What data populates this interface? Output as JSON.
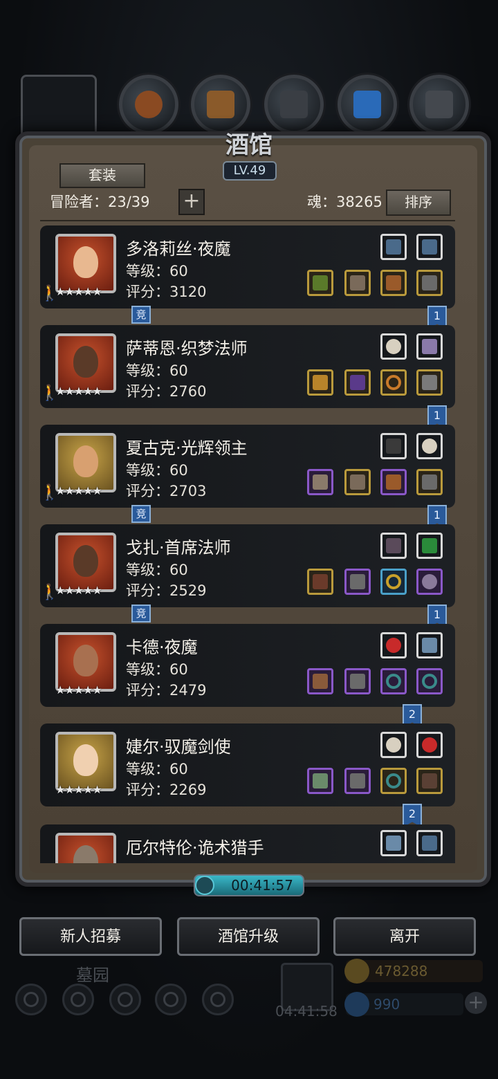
{
  "header": {
    "title": "酒馆",
    "level": "LV.49"
  },
  "toolbar": {
    "suit_label": "套装",
    "adventurers": "冒险者：23/39",
    "add_label": "+",
    "soul": "魂：38265",
    "sort_label": "排序"
  },
  "heroes": [
    {
      "name": "多洛莉丝·夜魔",
      "level": "等级：60",
      "score": "评分：3120",
      "stars": "★★★★★",
      "badge_left": "竞",
      "badge_right": "1"
    },
    {
      "name": "萨蒂恩·织梦法师",
      "level": "等级：60",
      "score": "评分：2760",
      "stars": "★★★★★",
      "badge_left": "",
      "badge_right": "1"
    },
    {
      "name": "夏古克·光辉领主",
      "level": "等级：60",
      "score": "评分：2703",
      "stars": "★★★★★",
      "badge_left": "竞",
      "badge_right": "1"
    },
    {
      "name": "戈扎·首席法师",
      "level": "等级：60",
      "score": "评分：2529",
      "stars": "★★★★★",
      "badge_left": "竞",
      "badge_right": "1"
    },
    {
      "name": "卡德·夜魔",
      "level": "等级：60",
      "score": "评分：2479",
      "stars": "★★★★★",
      "badge_left": "",
      "badge_right": "2"
    },
    {
      "name": "婕尔·驭魔剑使",
      "level": "等级：60",
      "score": "评分：2269",
      "stars": "★★★★★",
      "badge_left": "",
      "badge_right": "2"
    },
    {
      "name": "厄尔特伦·诡术猎手",
      "level": "",
      "score": "",
      "stars": "",
      "badge_left": "",
      "badge_right": ""
    }
  ],
  "timer": "00:41:57",
  "buttons": {
    "recruit": "新人招募",
    "upgrade": "酒馆升级",
    "leave": "离开"
  },
  "background": {
    "location": "墓园",
    "gift_timer": "04:41:58",
    "gold": "478288",
    "gems": "990"
  },
  "colors": {
    "gold_frame": "#b99a3c",
    "purple_frame": "#8a58c8",
    "blue_frame": "#4aa0c8",
    "white_frame": "#d8d8d8",
    "timer": "#3ab8c8"
  }
}
